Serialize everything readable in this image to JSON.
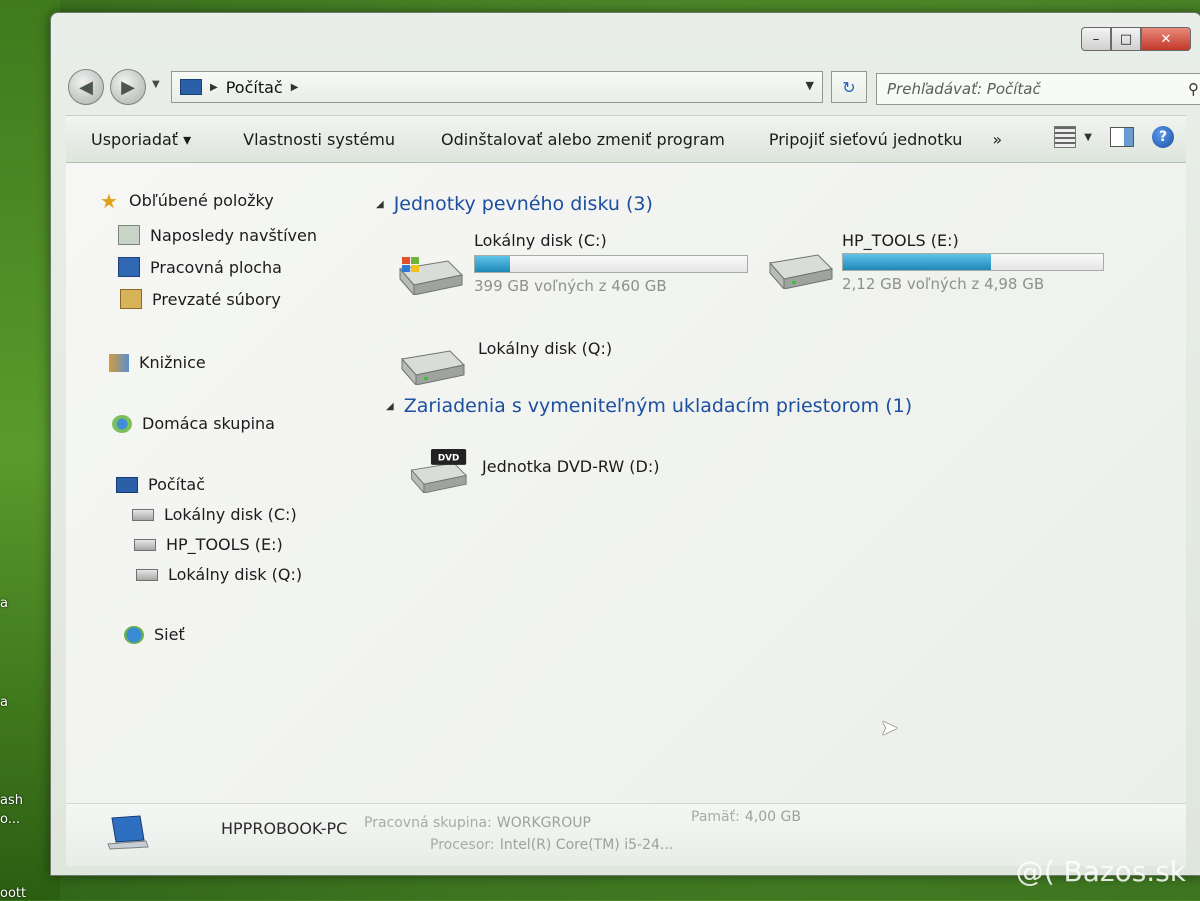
{
  "window": {
    "caption_min": "–",
    "caption_max": "□",
    "caption_close": "✕"
  },
  "nav": {
    "back_glyph": "◀",
    "forward_glyph": "▶",
    "address_path": "Počítač",
    "search_placeholder": "Prehľadávať: Počítač",
    "refresh_glyph": "↻"
  },
  "toolbar": {
    "organize": "Usporiadať ▾",
    "system_properties": "Vlastnosti systému",
    "uninstall": "Odinštalovať alebo zmeniť program",
    "map_drive": "Pripojiť sieťovú jednotku",
    "more": "»",
    "help_glyph": "?"
  },
  "sidebar": {
    "favorites": "Obľúbené položky",
    "recent": "Naposledy navštíven",
    "desktop": "Pracovná plocha",
    "downloads": "Prevzaté súbory",
    "libraries": "Knižnice",
    "homegroup": "Domáca skupina",
    "computer": "Počítač",
    "drive_c": "Lokálny disk (C:)",
    "drive_e": "HP_TOOLS (E:)",
    "drive_q": "Lokálny disk (Q:)",
    "network": "Sieť"
  },
  "main": {
    "hdd_group": "Jednotky pevného disku (3)",
    "removable_group": "Zariadenia s vymeniteľným ukladacím priestorom (1)",
    "drives": [
      {
        "name": "Lokálny disk (C:)",
        "free": "399 GB voľných z 460 GB",
        "used_fraction": 0.13
      },
      {
        "name": "HP_TOOLS (E:)",
        "free": "2,12 GB voľných z 4,98 GB",
        "used_fraction": 0.57
      },
      {
        "name": "Lokálny disk (Q:)"
      },
      {
        "name": "Jednotka DVD-RW (D:)",
        "badge": "DVD"
      }
    ]
  },
  "details": {
    "pc_name": "HPPROBOOK-PC",
    "workgroup_label": "Pracovná skupina:",
    "workgroup_value": "WORKGROUP",
    "memory_label": "Pamäť:",
    "memory_value": "4,00 GB",
    "cpu_label": "Procesor:",
    "cpu_value": "Intel(R) Core(TM) i5-24..."
  },
  "desktop": {
    "labels": [
      "a",
      "a",
      "ash",
      "o...",
      "oott"
    ]
  },
  "watermark": "@( Bazos.sk",
  "colors": {
    "accent_blue": "#1c4fa0",
    "bar_fill": "#1e88b8"
  }
}
